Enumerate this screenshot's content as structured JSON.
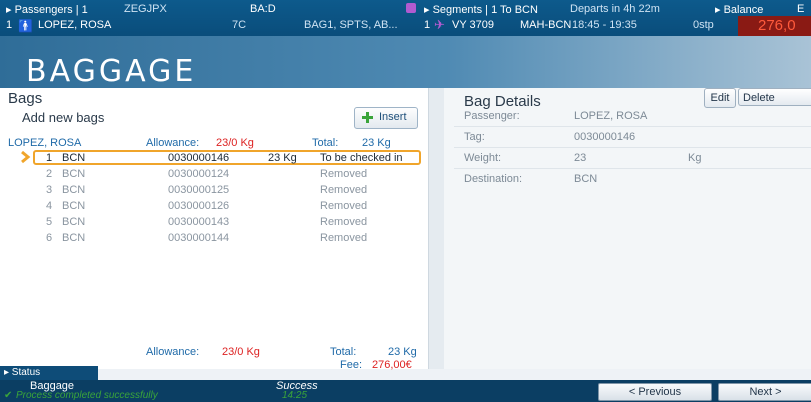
{
  "topbar": {
    "passengers_label": "▸ Passengers | 1",
    "pnr": "ZEGJPX",
    "ba_label": "BA:D",
    "segments_label": "▸ Segments | 1 To BCN",
    "departs": "Departs in 4h 22m",
    "balance_label": "▸ Balance",
    "balance_extra": "E",
    "pax_index": "1",
    "pax_name": "LOPEZ, ROSA",
    "seat": "7C",
    "ssr": "BAG1, SPTS, AB...",
    "seg_index": "1",
    "flight": "VY 3709",
    "route": "MAH-BCN",
    "times": "18:45 - 19:35",
    "stops": "0stp",
    "balance_value": "276,0"
  },
  "banner": {
    "title": "BAGGAGE"
  },
  "bags": {
    "heading": "Bags",
    "add_new": "Add new bags",
    "insert_label": "Insert",
    "header": {
      "name": "LOPEZ, ROSA",
      "allowance_label": "Allowance:",
      "allowance_value": "23/0 Kg",
      "total_label": "Total:",
      "total_value": "23 Kg"
    },
    "rows": [
      {
        "num": "1",
        "dest": "BCN",
        "tag": "0030000146",
        "weight": "23 Kg",
        "status": "To be checked in"
      },
      {
        "num": "2",
        "dest": "BCN",
        "tag": "0030000124",
        "weight": "",
        "status": "Removed"
      },
      {
        "num": "3",
        "dest": "BCN",
        "tag": "0030000125",
        "weight": "",
        "status": "Removed"
      },
      {
        "num": "4",
        "dest": "BCN",
        "tag": "0030000126",
        "weight": "",
        "status": "Removed"
      },
      {
        "num": "5",
        "dest": "BCN",
        "tag": "0030000143",
        "weight": "",
        "status": "Removed"
      },
      {
        "num": "6",
        "dest": "BCN",
        "tag": "0030000144",
        "weight": "",
        "status": "Removed"
      }
    ],
    "footer": {
      "allowance_label": "Allowance:",
      "allowance_value": "23/0 Kg",
      "total_label": "Total:",
      "total_value": "23 Kg",
      "fee_label": "Fee:",
      "fee_value": "276,00€"
    }
  },
  "details": {
    "title": "Bag Details",
    "edit_label": "Edit",
    "delete_label": "Delete",
    "passenger_label": "Passenger:",
    "passenger_value": "LOPEZ, ROSA",
    "tag_label": "Tag:",
    "tag_value": "0030000146",
    "weight_label": "Weight:",
    "weight_value": "23",
    "weight_unit": "Kg",
    "destination_label": "Destination:",
    "destination_value": "BCN"
  },
  "status": {
    "tab_label": "▸ Status",
    "module": "Baggage",
    "message": "Process completed successfully",
    "result": "Success",
    "time": "14:25"
  },
  "nav": {
    "previous_label": "< Previous",
    "next_label": "Next >"
  },
  "colors": {
    "accent": "#0d5a8c",
    "highlight": "#f0a52b",
    "alert": "#dd2222",
    "success": "#3aa43a"
  }
}
